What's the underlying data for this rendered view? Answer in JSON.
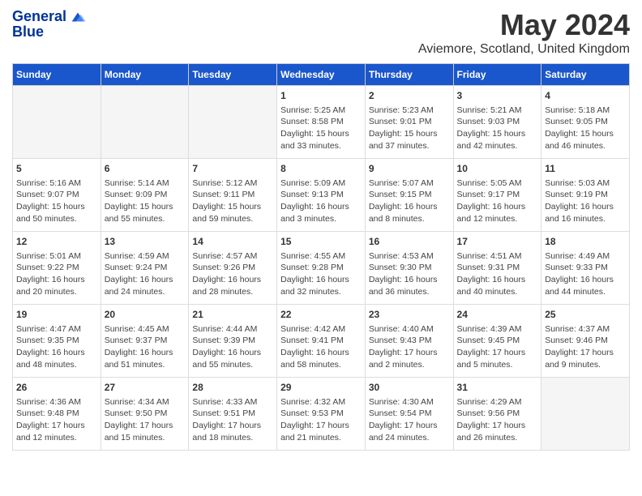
{
  "logo": {
    "line1": "General",
    "line2": "Blue"
  },
  "title": "May 2024",
  "subtitle": "Aviemore, Scotland, United Kingdom",
  "days_header": [
    "Sunday",
    "Monday",
    "Tuesday",
    "Wednesday",
    "Thursday",
    "Friday",
    "Saturday"
  ],
  "weeks": [
    [
      {
        "num": "",
        "info": "",
        "empty": true
      },
      {
        "num": "",
        "info": "",
        "empty": true
      },
      {
        "num": "",
        "info": "",
        "empty": true
      },
      {
        "num": "1",
        "info": "Sunrise: 5:25 AM\nSunset: 8:58 PM\nDaylight: 15 hours\nand 33 minutes.",
        "empty": false
      },
      {
        "num": "2",
        "info": "Sunrise: 5:23 AM\nSunset: 9:01 PM\nDaylight: 15 hours\nand 37 minutes.",
        "empty": false
      },
      {
        "num": "3",
        "info": "Sunrise: 5:21 AM\nSunset: 9:03 PM\nDaylight: 15 hours\nand 42 minutes.",
        "empty": false
      },
      {
        "num": "4",
        "info": "Sunrise: 5:18 AM\nSunset: 9:05 PM\nDaylight: 15 hours\nand 46 minutes.",
        "empty": false
      }
    ],
    [
      {
        "num": "5",
        "info": "Sunrise: 5:16 AM\nSunset: 9:07 PM\nDaylight: 15 hours\nand 50 minutes.",
        "empty": false
      },
      {
        "num": "6",
        "info": "Sunrise: 5:14 AM\nSunset: 9:09 PM\nDaylight: 15 hours\nand 55 minutes.",
        "empty": false
      },
      {
        "num": "7",
        "info": "Sunrise: 5:12 AM\nSunset: 9:11 PM\nDaylight: 15 hours\nand 59 minutes.",
        "empty": false
      },
      {
        "num": "8",
        "info": "Sunrise: 5:09 AM\nSunset: 9:13 PM\nDaylight: 16 hours\nand 3 minutes.",
        "empty": false
      },
      {
        "num": "9",
        "info": "Sunrise: 5:07 AM\nSunset: 9:15 PM\nDaylight: 16 hours\nand 8 minutes.",
        "empty": false
      },
      {
        "num": "10",
        "info": "Sunrise: 5:05 AM\nSunset: 9:17 PM\nDaylight: 16 hours\nand 12 minutes.",
        "empty": false
      },
      {
        "num": "11",
        "info": "Sunrise: 5:03 AM\nSunset: 9:19 PM\nDaylight: 16 hours\nand 16 minutes.",
        "empty": false
      }
    ],
    [
      {
        "num": "12",
        "info": "Sunrise: 5:01 AM\nSunset: 9:22 PM\nDaylight: 16 hours\nand 20 minutes.",
        "empty": false
      },
      {
        "num": "13",
        "info": "Sunrise: 4:59 AM\nSunset: 9:24 PM\nDaylight: 16 hours\nand 24 minutes.",
        "empty": false
      },
      {
        "num": "14",
        "info": "Sunrise: 4:57 AM\nSunset: 9:26 PM\nDaylight: 16 hours\nand 28 minutes.",
        "empty": false
      },
      {
        "num": "15",
        "info": "Sunrise: 4:55 AM\nSunset: 9:28 PM\nDaylight: 16 hours\nand 32 minutes.",
        "empty": false
      },
      {
        "num": "16",
        "info": "Sunrise: 4:53 AM\nSunset: 9:30 PM\nDaylight: 16 hours\nand 36 minutes.",
        "empty": false
      },
      {
        "num": "17",
        "info": "Sunrise: 4:51 AM\nSunset: 9:31 PM\nDaylight: 16 hours\nand 40 minutes.",
        "empty": false
      },
      {
        "num": "18",
        "info": "Sunrise: 4:49 AM\nSunset: 9:33 PM\nDaylight: 16 hours\nand 44 minutes.",
        "empty": false
      }
    ],
    [
      {
        "num": "19",
        "info": "Sunrise: 4:47 AM\nSunset: 9:35 PM\nDaylight: 16 hours\nand 48 minutes.",
        "empty": false
      },
      {
        "num": "20",
        "info": "Sunrise: 4:45 AM\nSunset: 9:37 PM\nDaylight: 16 hours\nand 51 minutes.",
        "empty": false
      },
      {
        "num": "21",
        "info": "Sunrise: 4:44 AM\nSunset: 9:39 PM\nDaylight: 16 hours\nand 55 minutes.",
        "empty": false
      },
      {
        "num": "22",
        "info": "Sunrise: 4:42 AM\nSunset: 9:41 PM\nDaylight: 16 hours\nand 58 minutes.",
        "empty": false
      },
      {
        "num": "23",
        "info": "Sunrise: 4:40 AM\nSunset: 9:43 PM\nDaylight: 17 hours\nand 2 minutes.",
        "empty": false
      },
      {
        "num": "24",
        "info": "Sunrise: 4:39 AM\nSunset: 9:45 PM\nDaylight: 17 hours\nand 5 minutes.",
        "empty": false
      },
      {
        "num": "25",
        "info": "Sunrise: 4:37 AM\nSunset: 9:46 PM\nDaylight: 17 hours\nand 9 minutes.",
        "empty": false
      }
    ],
    [
      {
        "num": "26",
        "info": "Sunrise: 4:36 AM\nSunset: 9:48 PM\nDaylight: 17 hours\nand 12 minutes.",
        "empty": false
      },
      {
        "num": "27",
        "info": "Sunrise: 4:34 AM\nSunset: 9:50 PM\nDaylight: 17 hours\nand 15 minutes.",
        "empty": false
      },
      {
        "num": "28",
        "info": "Sunrise: 4:33 AM\nSunset: 9:51 PM\nDaylight: 17 hours\nand 18 minutes.",
        "empty": false
      },
      {
        "num": "29",
        "info": "Sunrise: 4:32 AM\nSunset: 9:53 PM\nDaylight: 17 hours\nand 21 minutes.",
        "empty": false
      },
      {
        "num": "30",
        "info": "Sunrise: 4:30 AM\nSunset: 9:54 PM\nDaylight: 17 hours\nand 24 minutes.",
        "empty": false
      },
      {
        "num": "31",
        "info": "Sunrise: 4:29 AM\nSunset: 9:56 PM\nDaylight: 17 hours\nand 26 minutes.",
        "empty": false
      },
      {
        "num": "",
        "info": "",
        "empty": true
      }
    ]
  ]
}
